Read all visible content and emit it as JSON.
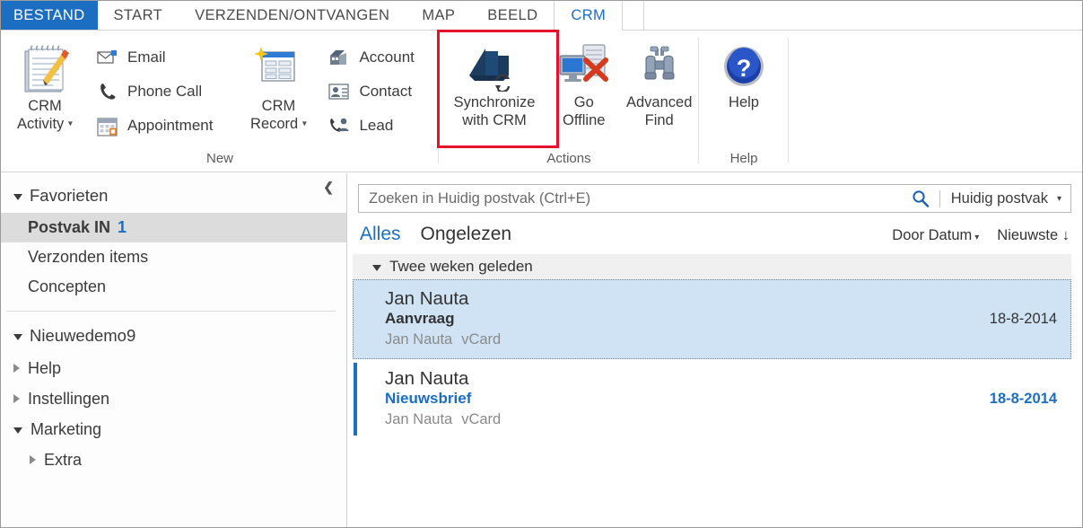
{
  "ribbon": {
    "tabs": [
      {
        "id": "file",
        "label": "BESTAND"
      },
      {
        "id": "home",
        "label": "START"
      },
      {
        "id": "send",
        "label": "VERZENDEN/ONTVANGEN"
      },
      {
        "id": "folder",
        "label": "MAP"
      },
      {
        "id": "view",
        "label": "BEELD"
      },
      {
        "id": "crm",
        "label": "CRM"
      }
    ],
    "active_tab": "CRM",
    "groups": [
      {
        "label": "New",
        "big_button": {
          "line1": "CRM",
          "line2": "Activity",
          "icon": "crm-activity-notepad-icon",
          "has_caret": true
        },
        "small_buttons": [
          {
            "label": "Email",
            "icon": "email-icon"
          },
          {
            "label": "Phone Call",
            "icon": "phone-icon"
          },
          {
            "label": "Appointment",
            "icon": "calendar-icon"
          }
        ]
      },
      {
        "label": "",
        "big_button": {
          "line1": "CRM",
          "line2": "Record",
          "icon": "crm-record-icon",
          "has_caret": true
        },
        "small_buttons": [
          {
            "label": "Account",
            "icon": "account-icon"
          },
          {
            "label": "Contact",
            "icon": "contact-icon"
          },
          {
            "label": "Lead",
            "icon": "lead-icon"
          }
        ]
      },
      {
        "label": "Actions",
        "buttons": [
          {
            "line1": "Synchronize",
            "line2": "with CRM",
            "icon": "dynamics-sync-icon",
            "highlighted": true
          },
          {
            "line1": "Go",
            "line2": "Offline",
            "icon": "go-offline-icon",
            "highlighted": false
          },
          {
            "line1": "Advanced",
            "line2": "Find",
            "icon": "binoculars-icon",
            "highlighted": false
          }
        ]
      },
      {
        "label": "Help",
        "buttons": [
          {
            "line1": "Help",
            "line2": "",
            "icon": "help-question-icon",
            "highlighted": false
          }
        ]
      }
    ],
    "highlight_color": "#e8112d"
  },
  "sidebar": {
    "collapse_icon": "❮",
    "favorites": {
      "label": "Favorieten",
      "items": [
        {
          "label": "Postvak IN",
          "count": "1",
          "selected": true
        },
        {
          "label": "Verzonden items",
          "count": "",
          "selected": false
        },
        {
          "label": "Concepten",
          "count": "",
          "selected": false
        }
      ]
    },
    "account": {
      "label": "Nieuwedemo9",
      "items": [
        {
          "label": "Help",
          "expanded": false,
          "indent": false
        },
        {
          "label": "Instellingen",
          "expanded": false,
          "indent": false
        },
        {
          "label": "Marketing",
          "expanded": true,
          "indent": false
        },
        {
          "label": "Extra",
          "expanded": false,
          "indent": true
        }
      ]
    }
  },
  "search": {
    "placeholder": "Zoeken in Huidig postvak (Ctrl+E)",
    "value": "",
    "icon": "search-icon",
    "scope_label": "Huidig postvak"
  },
  "filters": {
    "all_label": "Alles",
    "unread_label": "Ongelezen",
    "sort_label": "Door Datum",
    "order_label": "Nieuwste",
    "order_arrow": "↓"
  },
  "message_list": {
    "group_header": "Twee weken geleden",
    "messages": [
      {
        "from": "Jan Nauta",
        "subject": "Aanvraag",
        "preview_sender": "Jan Nauta",
        "preview_attachment": "vCard",
        "date": "18-8-2014",
        "unread": false,
        "selected": true
      },
      {
        "from": "Jan Nauta",
        "subject": "Nieuwsbrief",
        "preview_sender": "Jan Nauta",
        "preview_attachment": "vCard",
        "date": "18-8-2014",
        "unread": true,
        "selected": false
      }
    ]
  },
  "colors": {
    "accent": "#1b6ec2",
    "file_tab": "#1b6ec2",
    "selection": "#cfe3f5",
    "highlight": "#e8112d"
  }
}
